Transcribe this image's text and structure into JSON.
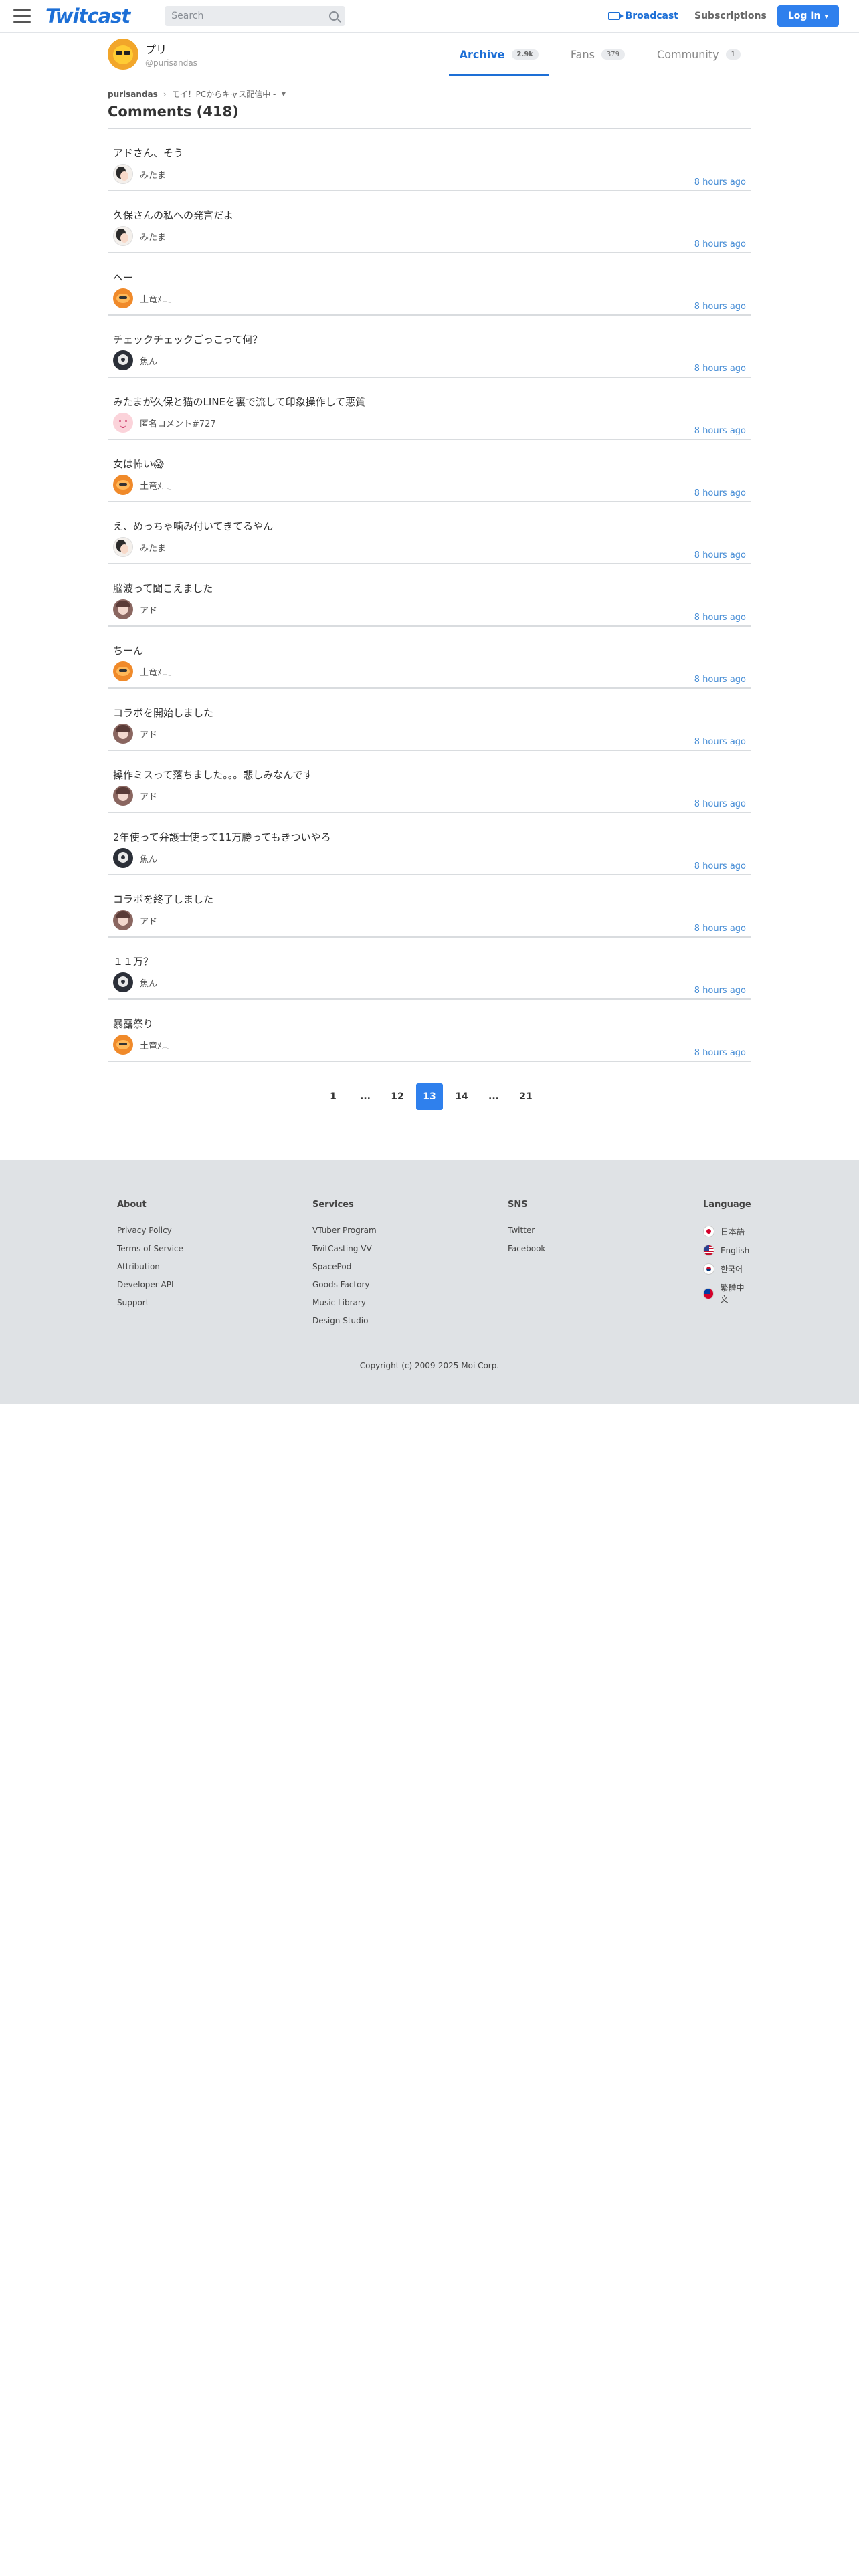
{
  "header": {
    "logo": "Twitcast",
    "search_placeholder": "Search",
    "broadcast_label": "Broadcast",
    "subscriptions_label": "Subscriptions",
    "login_label": "Log In"
  },
  "profile": {
    "name": "プリ",
    "handle": "@purisandas",
    "tabs": [
      {
        "label": "Archive",
        "count": "2.9k",
        "active": true
      },
      {
        "label": "Fans",
        "count": "379",
        "active": false
      },
      {
        "label": "Community",
        "count": "1",
        "active": false
      }
    ]
  },
  "breadcrumb": {
    "user": "purisandas",
    "movie": "モイ！PCからキャス配信中 -"
  },
  "page_title": "Comments (418)",
  "comments": [
    {
      "text": "アドさん、そう",
      "user": "みたま",
      "avatar": "mitama",
      "time": "8 hours ago"
    },
    {
      "text": "久保さんの私への発言だよ",
      "user": "みたま",
      "avatar": "mitama",
      "time": "8 hours ago"
    },
    {
      "text": "へー",
      "user": "土竜ﾒ𓂃",
      "avatar": "dokame",
      "time": "8 hours ago"
    },
    {
      "text": "チェックチェックごっこって何？",
      "user": "魚ん",
      "avatar": "gyokun",
      "time": "8 hours ago"
    },
    {
      "text": "みたまが久保と猫のLINEを裏で流して印象操作して悪質",
      "user": "匿名コメント#727",
      "avatar": "anon",
      "time": "8 hours ago"
    },
    {
      "text": "女は怖い😱",
      "user": "土竜ﾒ𓂃",
      "avatar": "dokame",
      "time": "8 hours ago"
    },
    {
      "text": "え、めっちゃ噛み付いてきてるやん",
      "user": "みたま",
      "avatar": "mitama",
      "time": "8 hours ago"
    },
    {
      "text": "脳波って聞こえました",
      "user": "アド",
      "avatar": "ado",
      "time": "8 hours ago"
    },
    {
      "text": "ちーん",
      "user": "土竜ﾒ𓂃",
      "avatar": "dokame",
      "time": "8 hours ago"
    },
    {
      "text": "コラボを開始しました",
      "user": "アド",
      "avatar": "ado",
      "time": "8 hours ago"
    },
    {
      "text": "操作ミスって落ちました。。。悲しみなんです",
      "user": "アド",
      "avatar": "ado",
      "time": "8 hours ago"
    },
    {
      "text": "2年使って弁護士使って11万勝ってもきついやろ",
      "user": "魚ん",
      "avatar": "gyokun",
      "time": "8 hours ago"
    },
    {
      "text": "コラボを終了しました",
      "user": "アド",
      "avatar": "ado",
      "time": "8 hours ago"
    },
    {
      "text": "１１万？",
      "user": "魚ん",
      "avatar": "gyokun",
      "time": "8 hours ago"
    },
    {
      "text": "暴露祭り",
      "user": "土竜ﾒ𓂃",
      "avatar": "dokame",
      "time": "8 hours ago"
    }
  ],
  "pagination": [
    {
      "label": "1",
      "current": false
    },
    {
      "label": "...",
      "current": false,
      "ellipsis": true
    },
    {
      "label": "12",
      "current": false
    },
    {
      "label": "13",
      "current": true
    },
    {
      "label": "14",
      "current": false
    },
    {
      "label": "...",
      "current": false,
      "ellipsis": true
    },
    {
      "label": "21",
      "current": false
    }
  ],
  "footer": {
    "about": {
      "heading": "About",
      "links": [
        "Privacy Policy",
        "Terms of Service",
        "Attribution",
        "Developer API",
        "Support"
      ]
    },
    "services": {
      "heading": "Services",
      "links": [
        "VTuber Program",
        "TwitCasting VV",
        "SpacePod",
        "Goods Factory",
        "Music Library",
        "Design Studio"
      ]
    },
    "sns": {
      "heading": "SNS",
      "links": [
        "Twitter",
        "Facebook"
      ]
    },
    "language": {
      "heading": "Language",
      "items": [
        {
          "label": "日本語",
          "flag": "jp"
        },
        {
          "label": "English",
          "flag": "us"
        },
        {
          "label": "한국어",
          "flag": "kr"
        },
        {
          "label": "繁體中文",
          "flag": "tw"
        }
      ]
    },
    "copyright": "Copyright (c) 2009-2025 Moi Corp."
  },
  "colors": {
    "accent": "#2f80ed",
    "link_time": "#4a8fd6",
    "footer_bg": "#dfe2e5"
  }
}
